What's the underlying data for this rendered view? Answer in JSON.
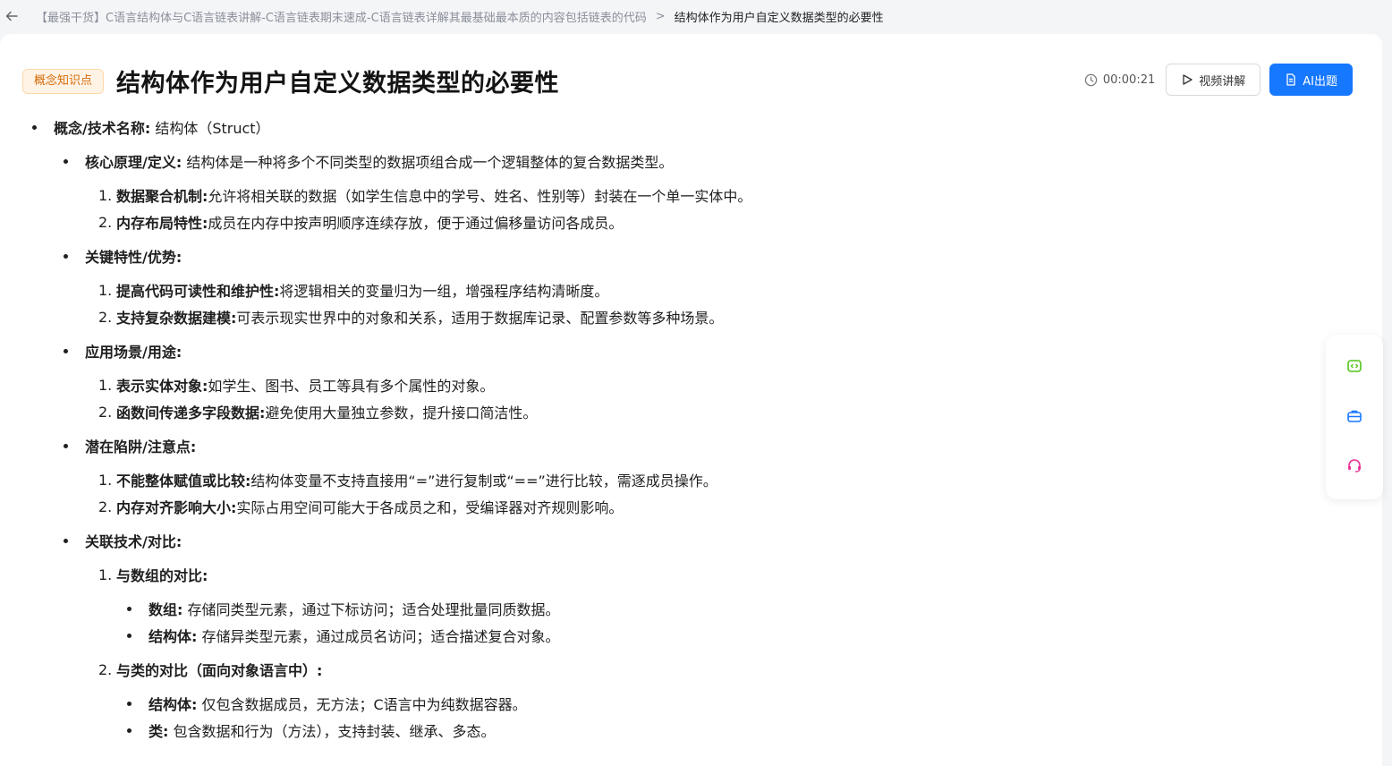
{
  "breadcrumb": {
    "items": [
      "【最强干货】C语言结构体与C语言链表讲解-C语言链表期末速成-C语言链表详解其最基础最本质的内容包括链表的代码",
      "结构体作为用户自定义数据类型的必要性"
    ],
    "separator": ">"
  },
  "header": {
    "tag": "概念知识点",
    "title": "结构体作为用户自定义数据类型的必要性",
    "timer": "00:00:21",
    "video_button": "视频讲解",
    "ai_button": "AI出题"
  },
  "content": {
    "concept": {
      "label": "概念/技术名称:",
      "text": " 结构体（Struct）"
    },
    "core": {
      "label": "核心原理/定义:",
      "text": " 结构体是一种将多个不同类型的数据项组合成一个逻辑整体的复合数据类型。"
    },
    "core_items": [
      {
        "num": "1.",
        "label": "数据聚合机制:",
        "text": " 允许将相关联的数据（如学生信息中的学号、姓名、性别等）封装在一个单一实体中。"
      },
      {
        "num": "2.",
        "label": "内存布局特性:",
        "text": " 成员在内存中按声明顺序连续存放，便于通过偏移量访问各成员。"
      }
    ],
    "features": {
      "label": "关键特性/优势:"
    },
    "feature_items": [
      {
        "num": "1.",
        "label": "提高代码可读性和维护性:",
        "text": " 将逻辑相关的变量归为一组，增强程序结构清晰度。"
      },
      {
        "num": "2.",
        "label": "支持复杂数据建模:",
        "text": " 可表示现实世界中的对象和关系，适用于数据库记录、配置参数等多种场景。"
      }
    ],
    "usage": {
      "label": "应用场景/用途:"
    },
    "usage_items": [
      {
        "num": "1.",
        "label": "表示实体对象:",
        "text": " 如学生、图书、员工等具有多个属性的对象。"
      },
      {
        "num": "2.",
        "label": "函数间传递多字段数据:",
        "text": " 避免使用大量独立参数，提升接口简洁性。"
      }
    ],
    "pitfalls": {
      "label": "潜在陷阱/注意点:"
    },
    "pitfall_items": [
      {
        "num": "1.",
        "label": "不能整体赋值或比较:",
        "text": " 结构体变量不支持直接用“=”进行复制或“==”进行比较，需逐成员操作。"
      },
      {
        "num": "2.",
        "label": "内存对齐影响大小:",
        "text": " 实际占用空间可能大于各成员之和，受编译器对齐规则影响。"
      }
    ],
    "related": {
      "label": "关联技术/对比:"
    },
    "related_items": [
      {
        "num": "1.",
        "label": "与数组的对比:",
        "subs": [
          {
            "label": "数组:",
            "text": " 存储同类型元素，通过下标访问；适合处理批量同质数据。"
          },
          {
            "label": "结构体:",
            "text": " 存储异类型元素，通过成员名访问；适合描述复合对象。"
          }
        ]
      },
      {
        "num": "2.",
        "label": "与类的对比（面向对象语言中）:",
        "subs": [
          {
            "label": "结构体:",
            "text": " 仅包含数据成员，无方法；C语言中为纯数据容器。"
          },
          {
            "label": "类:",
            "text": " 包含数据和行为（方法），支持封装、继承、多态。"
          }
        ]
      }
    ]
  },
  "floating_tools": {
    "icons": [
      "chat-bot-icon",
      "toolbox-icon",
      "headset-icon"
    ],
    "colors": {
      "chat": "#52c41a",
      "toolbox": "#1677ff",
      "headset": "#eb2f96"
    }
  },
  "colors": {
    "primary": "#1677ff",
    "tag_text": "#d46b08",
    "tag_bg": "#fff3e6"
  }
}
